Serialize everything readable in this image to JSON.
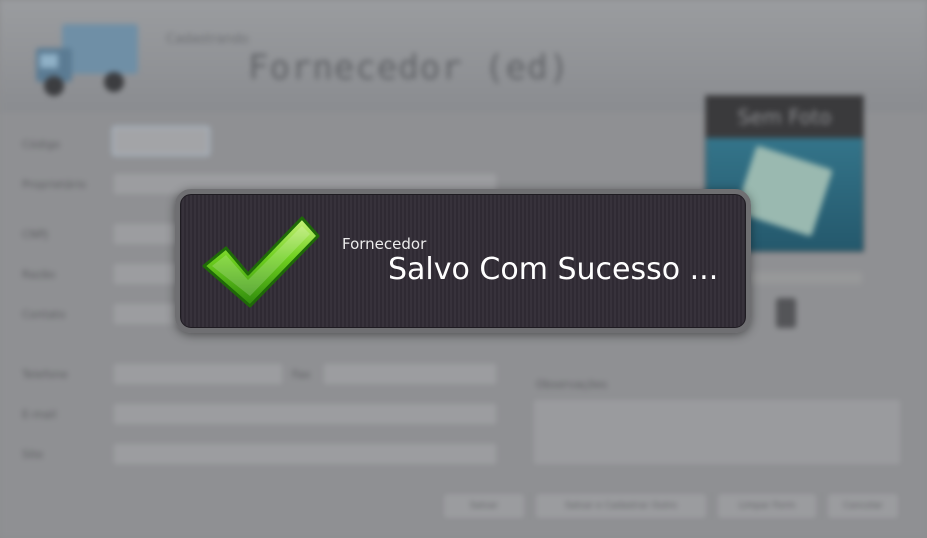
{
  "window": {
    "header_subtitle": "Cadastrando",
    "header_title": "Fornecedor (ed)"
  },
  "form": {
    "labels": [
      "Código",
      "Proprietário",
      "CNPJ",
      "Razão",
      "Contato",
      "Telefone",
      "Fax",
      "E-mail",
      "Site"
    ],
    "observacoes_label": "Observações"
  },
  "photo": {
    "placeholder_text": "Sem Foto"
  },
  "buttons": [
    "Salvar",
    "Salvar e Cadastrar Outro",
    "Limpar Form",
    "Cancelar"
  ],
  "toast": {
    "title": "Fornecedor",
    "message": "Salvo Com Sucesso ...",
    "icon": "check-icon",
    "accent_color": "#5fbf1a"
  }
}
